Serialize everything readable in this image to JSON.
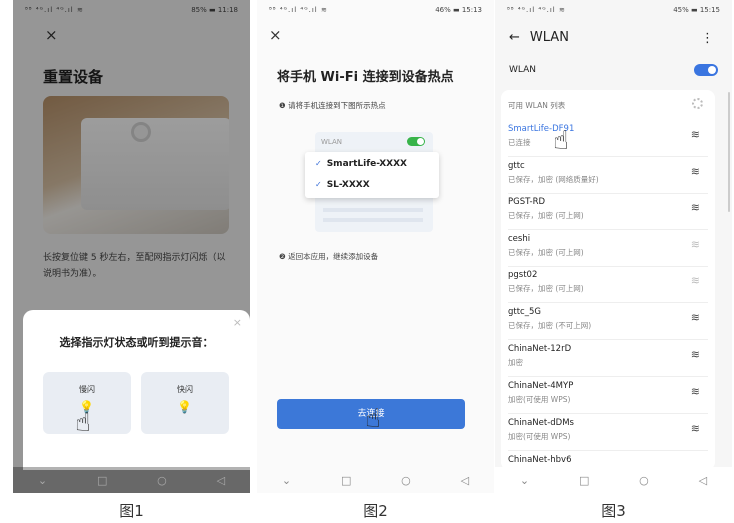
{
  "phone1": {
    "status_left": "⁸⁸ ⁴ᴳ.ıl ⁴ᴳ.ıl ≋",
    "status_right": "85% ▬ 11:18",
    "close": "×",
    "title": "重置设备",
    "desc": "长按复位键 5 秒左右，至配网指示灯闪烁（以说明书为准）。",
    "sheet_close": "×",
    "sheet_question": "选择指示灯状态或听到提示音：",
    "options": [
      {
        "label": "慢闪"
      },
      {
        "label": "快闪"
      }
    ],
    "caption": "图1"
  },
  "phone2": {
    "status_left": "⁸⁸ ⁴ᴳ.ıl ⁴ᴳ.ıl ≋",
    "status_right": "46% ▬ 15:13",
    "close": "×",
    "title": "将手机 Wi-Fi 连接到设备热点",
    "step1": "❶ 请将手机连接到下图所示热点",
    "wlan_label": "WLAN",
    "networks": [
      "SmartLife-XXXX",
      "SL-XXXX"
    ],
    "step2": "❷ 返回本应用，继续添加设备",
    "button": "去连接",
    "caption": "图2"
  },
  "phone3": {
    "status_left": "⁸⁸ ⁴ᴳ.ıl ⁴ᴳ.ıl ≋",
    "status_right": "45% ▬ 15:15",
    "header": "WLAN",
    "wlan_row": "WLAN",
    "list_header": "可用 WLAN 列表",
    "networks": [
      {
        "name": "SmartLife-DF91",
        "status": "已连接"
      },
      {
        "name": "gttc",
        "status": "已保存，加密 (网络质量好)"
      },
      {
        "name": "PGST-RD",
        "status": "已保存，加密 (可上网)"
      },
      {
        "name": "ceshi",
        "status": "已保存，加密 (可上网)"
      },
      {
        "name": "pgst02",
        "status": "已保存，加密 (可上网)"
      },
      {
        "name": "gttc_5G",
        "status": "已保存，加密 (不可上网)"
      },
      {
        "name": "ChinaNet-12rD",
        "status": "加密"
      },
      {
        "name": "ChinaNet-4MYP",
        "status": "加密(可使用 WPS)"
      },
      {
        "name": "ChinaNet-dDMs",
        "status": "加密(可使用 WPS)"
      },
      {
        "name": "ChinaNet-hbv6",
        "status": ""
      }
    ],
    "caption": "图3"
  },
  "nav": {
    "back": "◁",
    "home": "○",
    "recent": "□",
    "down": "⌄"
  },
  "icons": {
    "hand": "hand-pointer-icon",
    "wifi": "wifi-icon",
    "bulb": "light-bulb-icon"
  }
}
